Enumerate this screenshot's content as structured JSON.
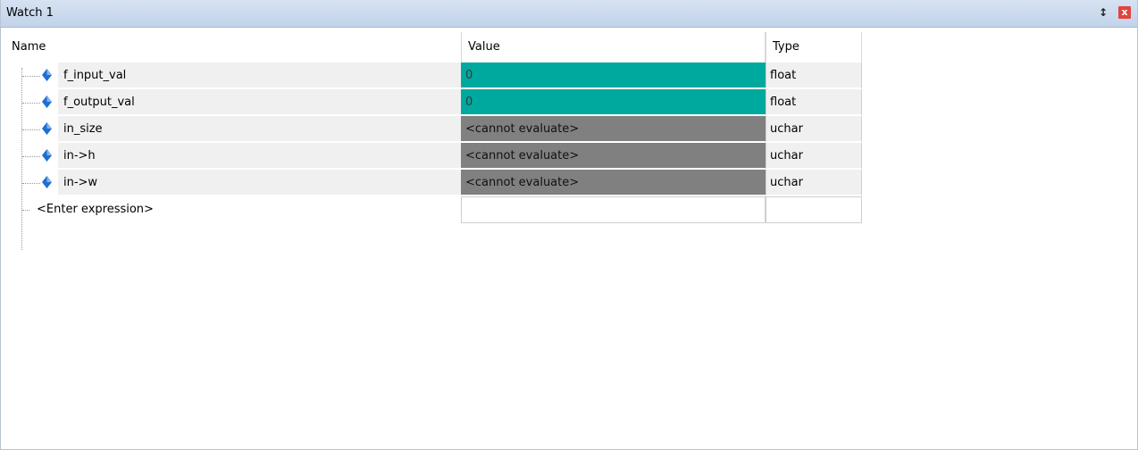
{
  "panel": {
    "title": "Watch 1",
    "pin_icon": "pin-icon",
    "close_icon": "close-icon",
    "close_glyph": "x"
  },
  "columns": {
    "name": "Name",
    "value": "Value",
    "type": "Type"
  },
  "colors": {
    "changed_value": "#00a99d",
    "unavailable_value": "#808080",
    "name_bg": "#f0f0f0"
  },
  "rows": [
    {
      "name": "f_input_val",
      "value": "0",
      "type": "float",
      "state": "teal"
    },
    {
      "name": "f_output_val",
      "value": "0",
      "type": "float",
      "state": "teal"
    },
    {
      "name": "in_size",
      "value": "<cannot evaluate>",
      "type": "uchar",
      "state": "gray"
    },
    {
      "name": "in->h",
      "value": "<cannot evaluate>",
      "type": "uchar",
      "state": "gray"
    },
    {
      "name": "in->w",
      "value": "<cannot evaluate>",
      "type": "uchar",
      "state": "gray"
    }
  ],
  "enter_expression": {
    "label": "<Enter expression>",
    "value": "",
    "type": ""
  }
}
